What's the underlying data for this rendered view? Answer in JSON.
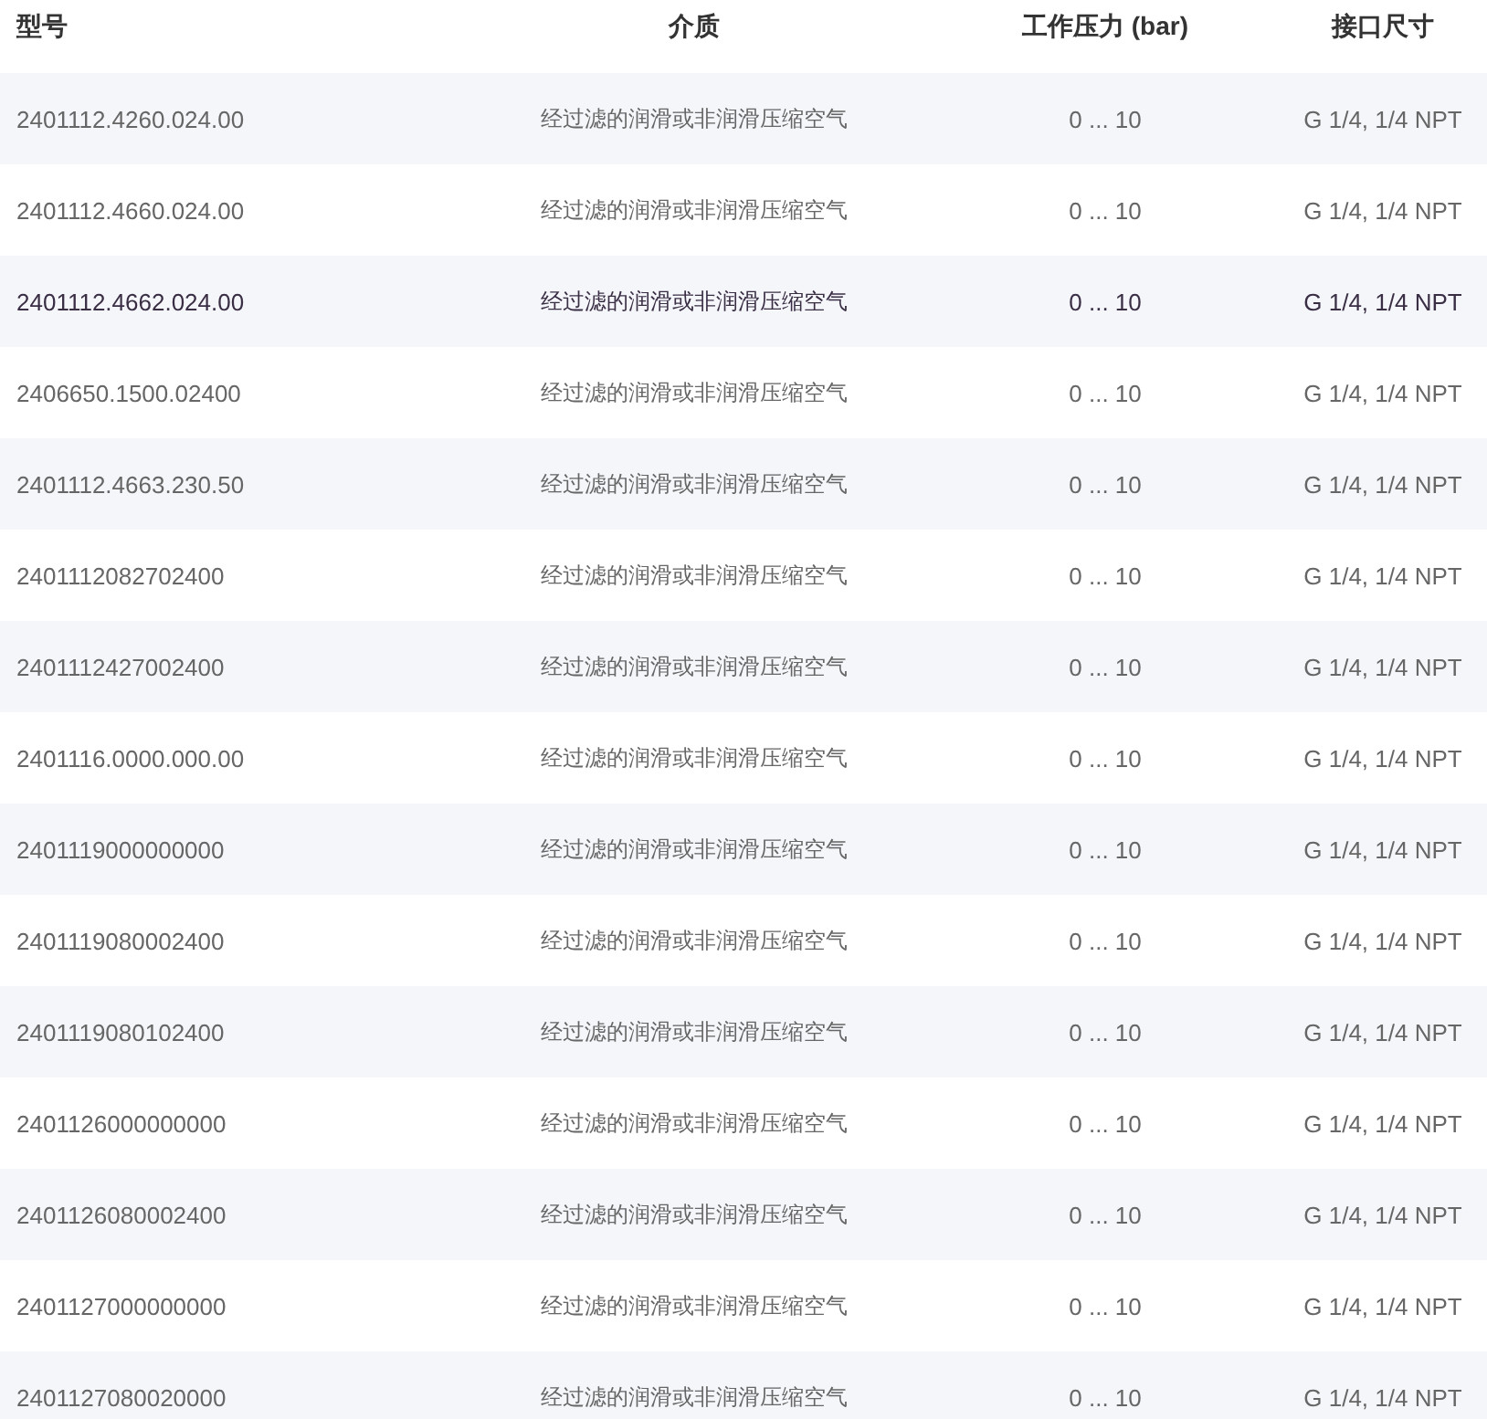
{
  "table": {
    "columns": [
      "型号",
      "介质",
      "工作压力 (bar)",
      "接口尺寸"
    ],
    "rows": [
      {
        "cells": [
          "2401112.4260.024.00",
          "经过滤的润滑或非润滑压缩空气",
          "0 ... 10",
          "G 1/4, 1/4 NPT"
        ],
        "selected": false
      },
      {
        "cells": [
          "2401112.4660.024.00",
          "经过滤的润滑或非润滑压缩空气",
          "0 ... 10",
          "G 1/4, 1/4 NPT"
        ],
        "selected": false
      },
      {
        "cells": [
          "2401112.4662.024.00",
          "经过滤的润滑或非润滑压缩空气",
          "0 ... 10",
          "G 1/4, 1/4 NPT"
        ],
        "selected": true
      },
      {
        "cells": [
          "2406650.1500.02400",
          "经过滤的润滑或非润滑压缩空气",
          "0 ... 10",
          "G 1/4, 1/4 NPT"
        ],
        "selected": false
      },
      {
        "cells": [
          "2401112.4663.230.50",
          "经过滤的润滑或非润滑压缩空气",
          "0 ... 10",
          "G 1/4, 1/4 NPT"
        ],
        "selected": false
      },
      {
        "cells": [
          "2401112082702400",
          "经过滤的润滑或非润滑压缩空气",
          "0 ... 10",
          "G 1/4, 1/4 NPT"
        ],
        "selected": false
      },
      {
        "cells": [
          "2401112427002400",
          "经过滤的润滑或非润滑压缩空气",
          "0 ... 10",
          "G 1/4, 1/4 NPT"
        ],
        "selected": false
      },
      {
        "cells": [
          "2401116.0000.000.00",
          "经过滤的润滑或非润滑压缩空气",
          "0 ... 10",
          "G 1/4, 1/4 NPT"
        ],
        "selected": false
      },
      {
        "cells": [
          "2401119000000000",
          "经过滤的润滑或非润滑压缩空气",
          "0 ... 10",
          "G 1/4, 1/4 NPT"
        ],
        "selected": false
      },
      {
        "cells": [
          "2401119080002400",
          "经过滤的润滑或非润滑压缩空气",
          "0 ... 10",
          "G 1/4, 1/4 NPT"
        ],
        "selected": false
      },
      {
        "cells": [
          "2401119080102400",
          "经过滤的润滑或非润滑压缩空气",
          "0 ... 10",
          "G 1/4, 1/4 NPT"
        ],
        "selected": false
      },
      {
        "cells": [
          "2401126000000000",
          "经过滤的润滑或非润滑压缩空气",
          "0 ... 10",
          "G 1/4, 1/4 NPT"
        ],
        "selected": false
      },
      {
        "cells": [
          "2401126080002400",
          "经过滤的润滑或非润滑压缩空气",
          "0 ... 10",
          "G 1/4, 1/4 NPT"
        ],
        "selected": false
      },
      {
        "cells": [
          "2401127000000000",
          "经过滤的润滑或非润滑压缩空气",
          "0 ... 10",
          "G 1/4, 1/4 NPT"
        ],
        "selected": false
      },
      {
        "cells": [
          "2401127080020000",
          "经过滤的润滑或非润滑压缩空气",
          "0 ... 10",
          "G 1/4, 1/4 NPT"
        ],
        "selected": false
      }
    ]
  }
}
